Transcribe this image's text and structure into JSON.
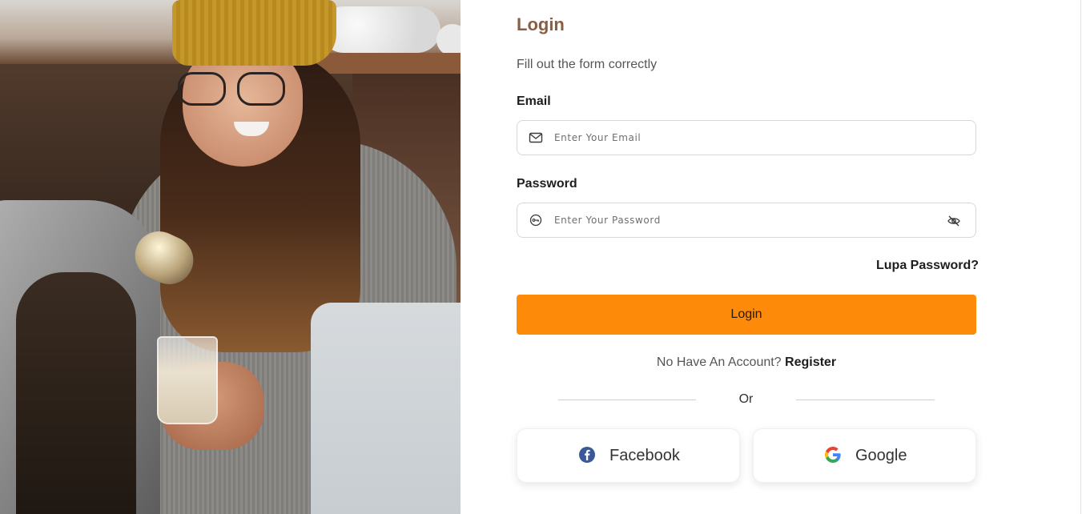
{
  "form": {
    "title": "Login",
    "subtitle": "Fill out the form correctly",
    "email_label": "Email",
    "email_placeholder": "Enter Your Email",
    "email_value": "",
    "password_label": "Password",
    "password_placeholder": "Enter Your Password",
    "password_value": "",
    "forgot_label": "Lupa Password?",
    "login_label": "Login",
    "no_account_text": "No Have An Account?",
    "register_label": "Register",
    "or_text": "Or"
  },
  "social": {
    "facebook_label": "Facebook",
    "google_label": "Google"
  },
  "icons": {
    "email": "mail-icon",
    "password": "key-icon",
    "toggle": "eye-off-icon",
    "facebook": "facebook-icon",
    "google": "google-icon"
  },
  "colors": {
    "accent": "#fd8a08",
    "title": "#8b5e44",
    "facebook": "#3b5998"
  }
}
